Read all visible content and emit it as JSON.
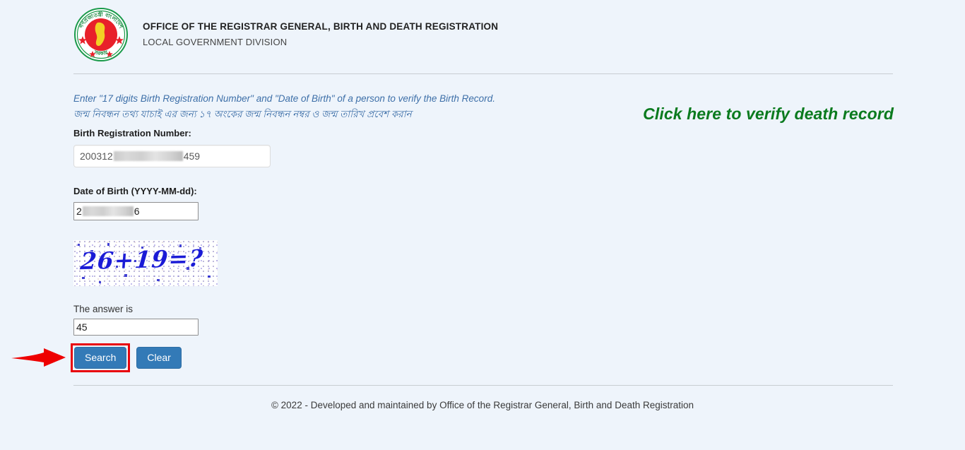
{
  "header": {
    "logo_icon": "bangladesh-government-seal-icon",
    "org_title": "OFFICE OF THE REGISTRAR GENERAL, BIRTH AND DEATH REGISTRATION",
    "org_subtitle": "LOCAL GOVERNMENT DIVISION"
  },
  "instructions": {
    "english": "Enter \"17 digits Birth Registration Number\" and \"Date of Birth\" of a person to verify the Birth Record.",
    "bengali": "জন্ম নিবন্ধন তথ্য যাচাই এর জন্য ১৭ অংকের জন্ম নিবন্ধন নম্বর ও জন্ম তারিখ প্রবেশ করান"
  },
  "death_link": {
    "label": "Click here to verify death record",
    "color": "#0a7a1e"
  },
  "form": {
    "brn": {
      "label": "Birth Registration Number:",
      "value_prefix": "200312",
      "value_suffix": "459",
      "redacted": true
    },
    "dob": {
      "label": "Date of Birth (YYYY-MM-dd):",
      "value_prefix": "2",
      "value_suffix": "6",
      "redacted": true
    },
    "captcha": {
      "question": "26+19=?",
      "answer_label": "The answer is",
      "answer_value": "45"
    },
    "buttons": {
      "search": "Search",
      "clear": "Clear"
    }
  },
  "annotation": {
    "arrow_icon": "red-arrow-right-icon",
    "highlight_color": "#e8000b",
    "target": "search-button"
  },
  "footer": {
    "text": "© 2022 - Developed and maintained by Office of the Registrar General, Birth and Death Registration"
  },
  "theme": {
    "page_background": "#eef4fb",
    "button_primary": "#337ab7",
    "instruction_text": "#3d6fa8",
    "captcha_text": "#1a1ad6"
  }
}
